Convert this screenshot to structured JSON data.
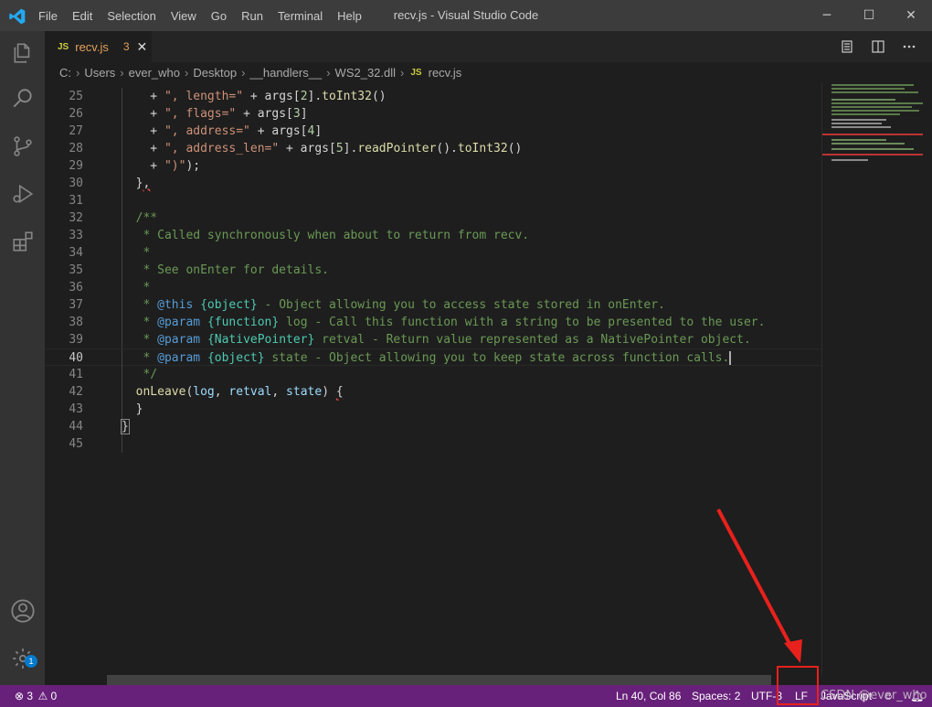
{
  "app": {
    "window_title": "recv.js - Visual Studio Code"
  },
  "menu": [
    "File",
    "Edit",
    "Selection",
    "View",
    "Go",
    "Run",
    "Terminal",
    "Help"
  ],
  "window_controls": {
    "minimize": "─",
    "maximize": "☐",
    "close": "✕"
  },
  "tab": {
    "file_icon": "JS",
    "name": "recv.js",
    "problem_count": "3",
    "close": "✕"
  },
  "breadcrumb": [
    "C:",
    "Users",
    "ever_who",
    "Desktop",
    "__handlers__",
    "WS2_32.dll"
  ],
  "breadcrumb_file": {
    "icon": "JS",
    "name": "recv.js"
  },
  "code_lines": [
    {
      "n": "25",
      "html": "    + <span class=\"str\">\", length=\"</span> + args[<span style=\"color:#b5cea8\">2</span>].<span class=\"fn\">toInt32</span>()"
    },
    {
      "n": "26",
      "html": "    + <span class=\"str\">\", flags=\"</span> + args[<span style=\"color:#b5cea8\">3</span>]"
    },
    {
      "n": "27",
      "html": "    + <span class=\"str\">\", address=\"</span> + args[<span style=\"color:#b5cea8\">4</span>]"
    },
    {
      "n": "28",
      "html": "    + <span class=\"str\">\", address_len=\"</span> + args[<span style=\"color:#b5cea8\">5</span>].<span class=\"fn\">readPointer</span>().<span class=\"fn\">toInt32</span>()"
    },
    {
      "n": "29",
      "html": "    + <span class=\"str\">\")\"</span>);"
    },
    {
      "n": "30",
      "html": "  }<span class=\"err\">,</span>"
    },
    {
      "n": "31",
      "html": ""
    },
    {
      "n": "32",
      "html": "  <span class=\"cm\">/**</span>"
    },
    {
      "n": "33",
      "html": "<span class=\"cm\">   * Called synchronously when about to return from recv.</span>"
    },
    {
      "n": "34",
      "html": "<span class=\"cm\">   *</span>"
    },
    {
      "n": "35",
      "html": "<span class=\"cm\">   * See onEnter for details.</span>"
    },
    {
      "n": "36",
      "html": "<span class=\"cm\">   *</span>"
    },
    {
      "n": "37",
      "html": "<span class=\"cm\">   * </span><span class=\"tag\">@this</span><span class=\"cm\"> </span><span class=\"typ\">{object}</span><span class=\"cm\"> - Object allowing you to access state stored in onEnter.</span>"
    },
    {
      "n": "38",
      "html": "<span class=\"cm\">   * </span><span class=\"tag\">@param</span><span class=\"cm\"> </span><span class=\"typ\">{function}</span><span class=\"cm\"> log - Call this function with a string to be presented to the user.</span>"
    },
    {
      "n": "39",
      "html": "<span class=\"cm\">   * </span><span class=\"tag\">@param</span><span class=\"cm\"> </span><span class=\"typ\">{NativePointer}</span><span class=\"cm\"> retval - Return value represented as a NativePointer object.</span>"
    },
    {
      "n": "40",
      "html": "<span class=\"cm\">   * </span><span class=\"tag\">@param</span><span class=\"cm\"> </span><span class=\"typ\">{object}</span><span class=\"cm\"> state - Object allowing you to keep state across function calls.</span><span style=\"border-left:2px solid #aeafad\"></span>",
      "current": true
    },
    {
      "n": "41",
      "html": "<span class=\"cm\">   */</span>"
    },
    {
      "n": "42",
      "html": "  <span class=\"fn\">onLeave</span>(<span class=\"var\">log</span>, <span class=\"var\">retval</span>, <span class=\"var\">state</span>) <span class=\"err\">{</span>"
    },
    {
      "n": "43",
      "html": "  }"
    },
    {
      "n": "44",
      "html": "<span style=\"outline:1px solid #888\">}</span>"
    },
    {
      "n": "45",
      "html": ""
    }
  ],
  "status": {
    "errors": "3",
    "warnings": "0",
    "position": "Ln 40, Col 86",
    "spaces": "Spaces: 2",
    "encoding": "UTF-8",
    "eol": "LF",
    "language": "JavaScript"
  },
  "watermark": "CSDN @ever_who",
  "colors": {
    "status_bar": "#68217a",
    "annotation": "#e8211c",
    "accent": "#007acc"
  }
}
